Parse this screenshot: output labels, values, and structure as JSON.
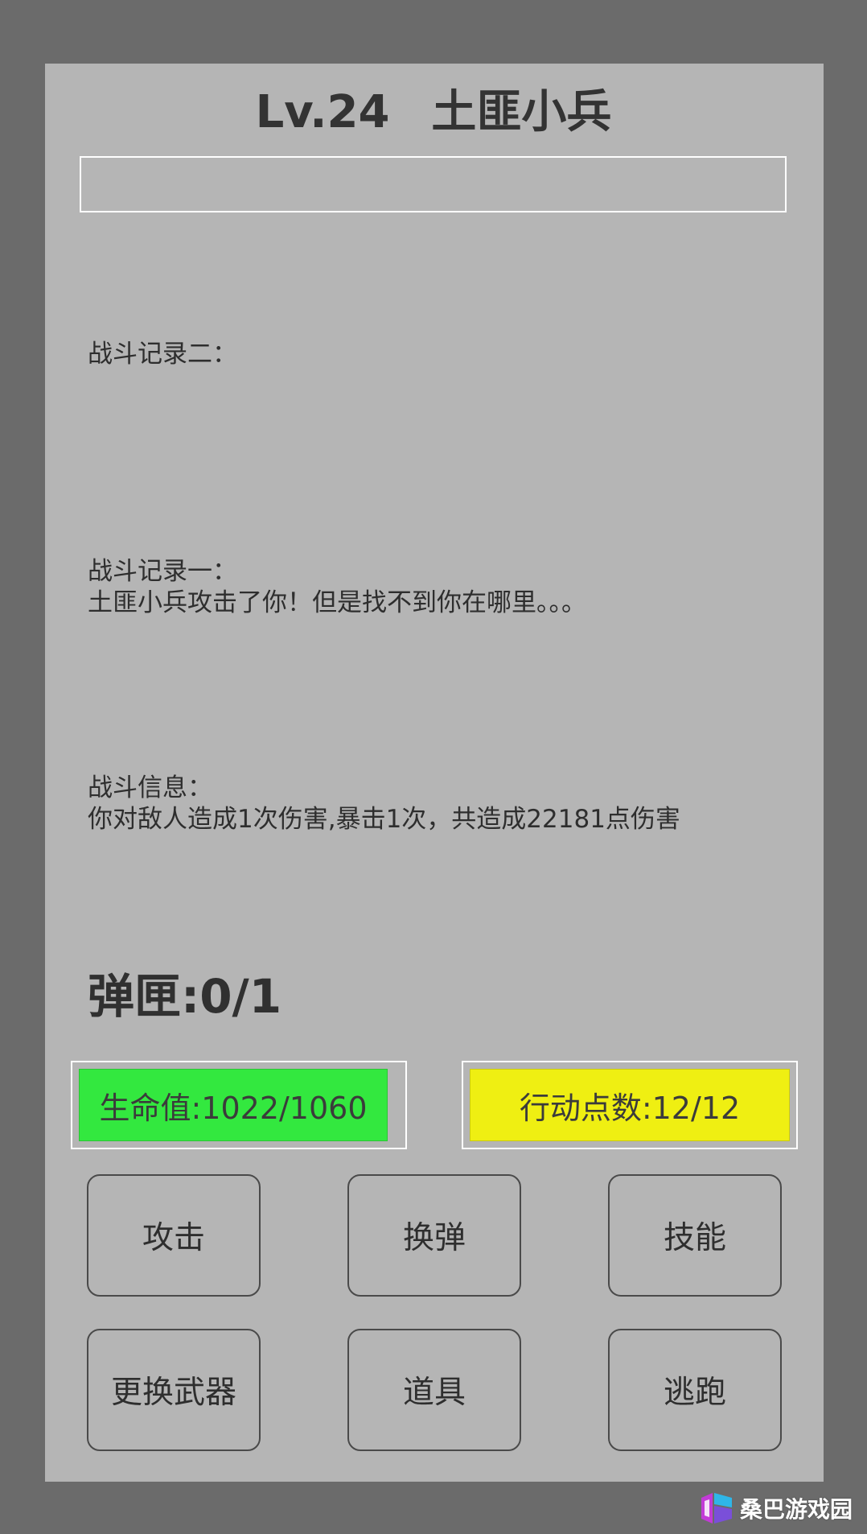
{
  "header": {
    "level": "Lv.24",
    "enemy_name": "土匪小兵"
  },
  "enemy_hp_bar": {
    "fill_fraction": 0
  },
  "battle_log": {
    "record_two": {
      "title": "战斗记录二：",
      "text": ""
    },
    "record_one": {
      "title": "战斗记录一：",
      "text": "土匪小兵攻击了你！但是找不到你在哪里。。。"
    },
    "info": {
      "title": "战斗信息：",
      "text": "你对敌人造成1次伤害,暴击1次，共造成22181点伤害"
    }
  },
  "ammo": {
    "label": "弹匣:0/1"
  },
  "stats": {
    "hp": "生命值:1022/1060",
    "action_points": "行动点数:12/12",
    "hp_color": "#33e83f",
    "ap_color": "#efef12"
  },
  "actions": {
    "attack": "攻击",
    "reload": "换弹",
    "skill": "技能",
    "change_weapon": "更换武器",
    "item": "道具",
    "flee": "逃跑"
  },
  "watermark": {
    "text": "桑巴游戏园",
    "icon": "site-logo-icon"
  }
}
